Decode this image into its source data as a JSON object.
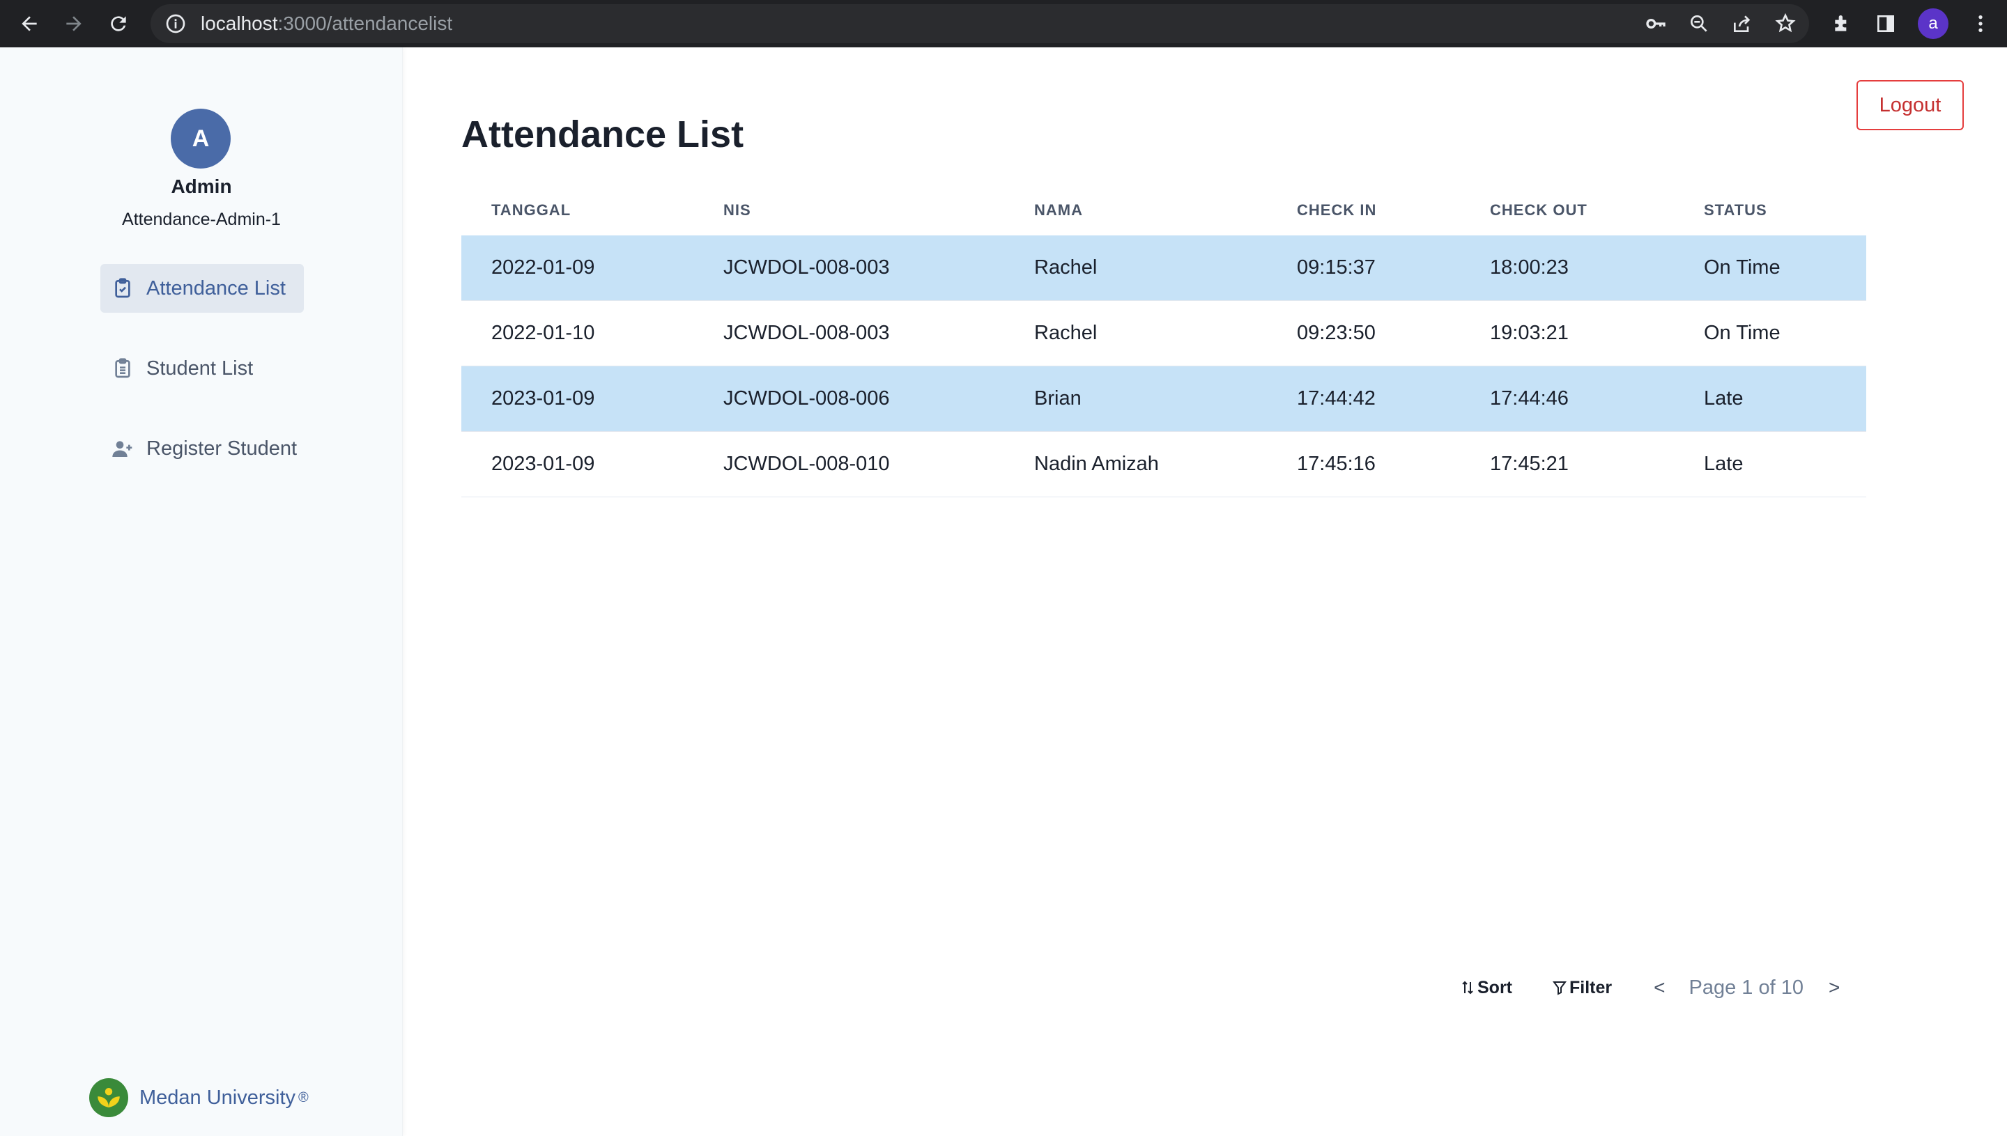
{
  "browser": {
    "url_host": "localhost",
    "url_path": ":3000/attendancelist",
    "profile_initial": "a"
  },
  "sidebar": {
    "avatar_initial": "A",
    "user_name": "Admin",
    "user_id": "Attendance-Admin-1",
    "items": [
      {
        "label": "Attendance List",
        "icon": "clipboard-icon",
        "active": true
      },
      {
        "label": "Student List",
        "icon": "clipboard-list-icon",
        "active": false
      },
      {
        "label": "Register Student",
        "icon": "user-plus-icon",
        "active": false
      }
    ],
    "brand": "Medan University",
    "brand_mark": "®"
  },
  "header": {
    "logout_label": "Logout",
    "title": "Attendance List"
  },
  "table": {
    "columns": [
      "TANGGAL",
      "NIS",
      "NAMA",
      "CHECK IN",
      "CHECK OUT",
      "STATUS"
    ],
    "rows": [
      [
        "2022-01-09",
        "JCWDOL-008-003",
        "Rachel",
        "09:15:37",
        "18:00:23",
        "On Time"
      ],
      [
        "2022-01-10",
        "JCWDOL-008-003",
        "Rachel",
        "09:23:50",
        "19:03:21",
        "On Time"
      ],
      [
        "2023-01-09",
        "JCWDOL-008-006",
        "Brian",
        "17:44:42",
        "17:44:46",
        "Late"
      ],
      [
        "2023-01-09",
        "JCWDOL-008-010",
        "Nadin Amizah",
        "17:45:16",
        "17:45:21",
        "Late"
      ]
    ]
  },
  "footer": {
    "sort_label": "Sort",
    "filter_label": "Filter",
    "prev": "<",
    "next": ">",
    "page_text": "Page 1 of 10"
  },
  "colors": {
    "accent": "#3f5f9a",
    "row_highlight": "#c6e2f7",
    "logout": "#e53e3e"
  }
}
